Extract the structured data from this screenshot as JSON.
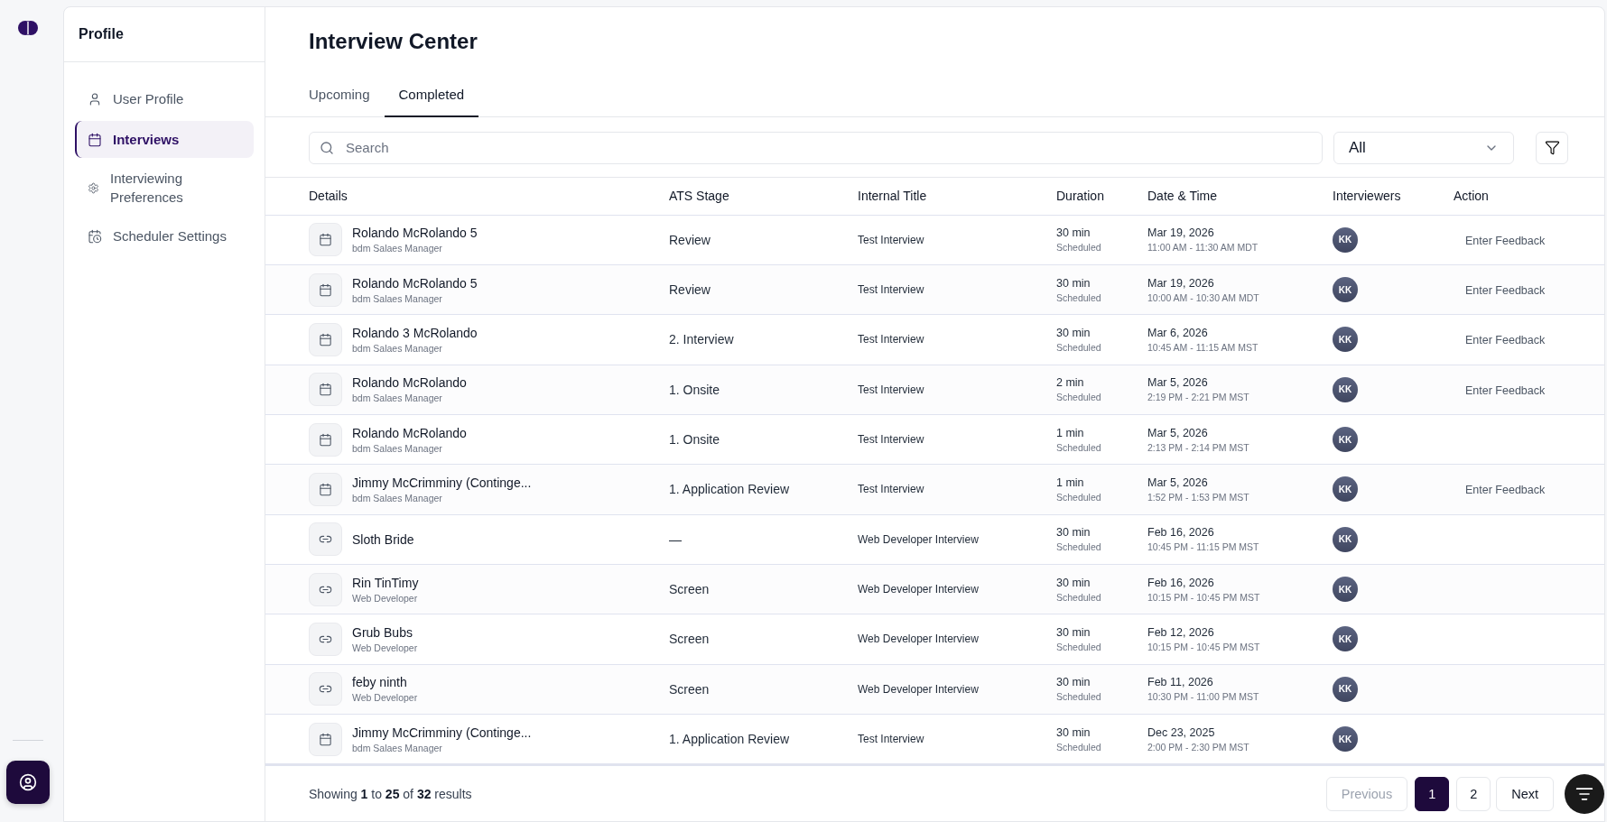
{
  "profile_nav": {
    "title": "Profile",
    "items": [
      {
        "label": "User Profile",
        "selected": false
      },
      {
        "label": "Interviews",
        "selected": true
      },
      {
        "label": "Interviewing Preferences",
        "selected": false
      },
      {
        "label": "Scheduler Settings",
        "selected": false
      }
    ]
  },
  "page": {
    "title": "Interview Center"
  },
  "tabs": [
    {
      "label": "Upcoming",
      "selected": false
    },
    {
      "label": "Completed",
      "selected": true
    }
  ],
  "search": {
    "placeholder": "Search"
  },
  "filter_select": {
    "value": "All"
  },
  "table": {
    "columns": [
      "Details",
      "ATS Stage",
      "Internal Title",
      "Duration",
      "Date & Time",
      "Interviewers",
      "Action"
    ],
    "rows": [
      {
        "kind": "calendar",
        "name": "Rolando McRolando 5",
        "role": "bdm Salaes Manager",
        "stage": "Review",
        "title": "Test Interview",
        "duration": "30 min",
        "status": "Scheduled",
        "date": "Mar 19, 2026",
        "time": "11:00 AM - 11:30 AM MDT",
        "interviewer": "KK",
        "action": "Enter Feedback"
      },
      {
        "kind": "calendar",
        "name": "Rolando McRolando 5",
        "role": "bdm Salaes Manager",
        "stage": "Review",
        "title": "Test Interview",
        "duration": "30 min",
        "status": "Scheduled",
        "date": "Mar 19, 2026",
        "time": "10:00 AM - 10:30 AM MDT",
        "interviewer": "KK",
        "action": "Enter Feedback"
      },
      {
        "kind": "calendar",
        "name": "Rolando 3 McRolando",
        "role": "bdm Salaes Manager",
        "stage": "2. Interview",
        "title": "Test Interview",
        "duration": "30 min",
        "status": "Scheduled",
        "date": "Mar 6, 2026",
        "time": "10:45 AM - 11:15 AM MST",
        "interviewer": "KK",
        "action": "Enter Feedback"
      },
      {
        "kind": "calendar",
        "name": "Rolando McRolando",
        "role": "bdm Salaes Manager",
        "stage": "1. Onsite",
        "title": "Test Interview",
        "duration": "2 min",
        "status": "Scheduled",
        "date": "Mar 5, 2026",
        "time": "2:19 PM - 2:21 PM MST",
        "interviewer": "KK",
        "action": "Enter Feedback"
      },
      {
        "kind": "calendar",
        "name": "Rolando McRolando",
        "role": "bdm Salaes Manager",
        "stage": "1. Onsite",
        "title": "Test Interview",
        "duration": "1 min",
        "status": "Scheduled",
        "date": "Mar 5, 2026",
        "time": "2:13 PM - 2:14 PM MST",
        "interviewer": "KK"
      },
      {
        "kind": "calendar",
        "name": "Jimmy McCrimminy (Continge...",
        "role": "bdm Salaes Manager",
        "stage": "1. Application Review",
        "title": "Test Interview",
        "duration": "1 min",
        "status": "Scheduled",
        "date": "Mar 5, 2026",
        "time": "1:52 PM - 1:53 PM MST",
        "interviewer": "KK",
        "action": "Enter Feedback"
      },
      {
        "kind": "link",
        "name": "Sloth Bride",
        "stage": "—",
        "title": "Web Developer Interview",
        "duration": "30 min",
        "status": "Scheduled",
        "date": "Feb 16, 2026",
        "time": "10:45 PM - 11:15 PM MST",
        "interviewer": "KK"
      },
      {
        "kind": "link",
        "name": "Rin TinTimy",
        "role": "Web Developer",
        "stage": "Screen",
        "title": "Web Developer Interview",
        "duration": "30 min",
        "status": "Scheduled",
        "date": "Feb 16, 2026",
        "time": "10:15 PM - 10:45 PM MST",
        "interviewer": "KK"
      },
      {
        "kind": "link",
        "name": "Grub Bubs",
        "role": "Web Developer",
        "stage": "Screen",
        "title": "Web Developer Interview",
        "duration": "30 min",
        "status": "Scheduled",
        "date": "Feb 12, 2026",
        "time": "10:15 PM - 10:45 PM MST",
        "interviewer": "KK"
      },
      {
        "kind": "link",
        "name": "feby ninth",
        "role": "Web Developer",
        "stage": "Screen",
        "title": "Web Developer Interview",
        "duration": "30 min",
        "status": "Scheduled",
        "date": "Feb 11, 2026",
        "time": "10:30 PM - 11:00 PM MST",
        "interviewer": "KK"
      },
      {
        "kind": "calendar",
        "name": "Jimmy McCrimminy (Continge...",
        "role": "bdm Salaes Manager",
        "stage": "1. Application Review",
        "title": "Test Interview",
        "duration": "30 min",
        "status": "Scheduled",
        "date": "Dec 23, 2025",
        "time": "2:00 PM - 2:30 PM MST",
        "interviewer": "KK"
      }
    ]
  },
  "footer": {
    "summary": "Showing **1** to **25** of **32** results",
    "pagination": [
      {
        "label": "Previous",
        "kind": "nav",
        "disabled": true
      },
      {
        "label": "1",
        "kind": "page",
        "selected": true
      },
      {
        "label": "2",
        "kind": "page",
        "selected": false
      },
      {
        "label": "Next",
        "kind": "nav",
        "disabled": false
      }
    ]
  }
}
